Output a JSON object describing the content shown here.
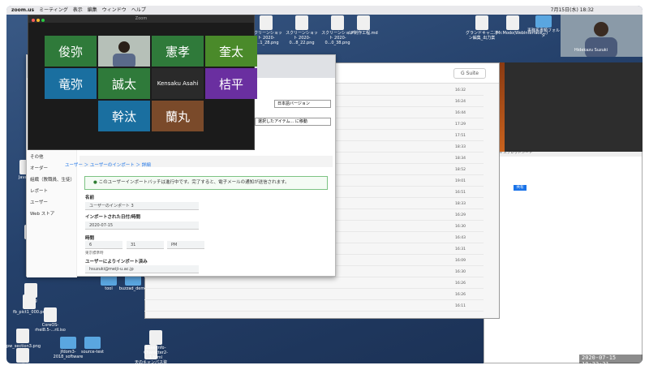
{
  "menubar": {
    "items": [
      "zoom.us",
      "ミーティング",
      "表示",
      "編集",
      "ウィンドウ",
      "ヘルプ"
    ],
    "clock": "7月15日(水) 18:32"
  },
  "desktop_icons": [
    {
      "label": "config"
    },
    {
      "label": "fb_pict1_000.png"
    },
    {
      "label": "CoreOS-rhel8.5-...ril.iso"
    },
    {
      "label": "pw_section3.png"
    },
    {
      "label": "Pepper資料.jpg"
    },
    {
      "label": "tool"
    },
    {
      "label": "buzzad_demo"
    },
    {
      "label": "jfdom3-2018_software"
    },
    {
      "label": "source-test"
    },
    {
      "label": "天のキャンパス資料 2020.pdf"
    },
    {
      "label": "base-info-Character2-1.html"
    },
    {
      "label": "Java-ka"
    },
    {
      "label": "Crea"
    }
  ],
  "top_icons": [
    {
      "label": "スクリーンショット 2020-0...1_28.png"
    },
    {
      "label": "スクリーンショット 2020-0...8_22.png"
    },
    {
      "label": "スクリーンショット 2020-0...0_38.png"
    },
    {
      "label": "LP制作工程.md"
    },
    {
      "label": "グランドキャニオン編集_出力案"
    },
    {
      "label": "Mr.Modo(WebInterface...)"
    },
    {
      "label": "事務系書類フォルダ"
    }
  ],
  "zoom": {
    "title": "Zoom",
    "participants": [
      {
        "name": "俊弥",
        "color": "#2f7a3a"
      },
      {
        "name": "",
        "color": "#6b6b6b",
        "video": true
      },
      {
        "name": "憲孝",
        "color": "#2f7a3a"
      },
      {
        "name": "奎太",
        "color": "#4a8a2a"
      },
      {
        "name": "竜弥",
        "color": "#1a6fa0"
      },
      {
        "name": "誠太",
        "color": "#2f7a3a"
      },
      {
        "name": "Kensaku Asahi",
        "color": "#2a2a2a",
        "small": true
      },
      {
        "name": "桔平",
        "color": "#6a2fa0"
      },
      {
        "name": "幹汰",
        "color": "#1a6fa0"
      },
      {
        "name": "蘭丸",
        "color": "#7a4a2a"
      }
    ]
  },
  "admin": {
    "sidebar": [
      "その他",
      "オーダー",
      "組織（教職員、生徒）",
      "レポート",
      "ユーザー",
      "Web ストア"
    ],
    "breadcrumb": "ユーザー ＞ ユーザーのインポート ＞ 詳細",
    "notice": "このユーザーインポートバッチは進行中です。完了すると、電子メールの通知が送信されます。",
    "name_label": "名前",
    "name_value": "ユーザーのインポート 3",
    "date_label": "インポートされた日付/時間",
    "date_value": "2020-07-15",
    "time_label": "時間",
    "hour": "6",
    "minute": "31",
    "ampm": "PM",
    "timezone": "東京標準時",
    "importer_label": "ユーザーによりインポート済み",
    "importer_value": "hsuzuki@meiji-u.ac.jp",
    "lang_select": "日本語バージョン",
    "move_select": "選択したアイテム... に移動"
  },
  "gmail": {
    "gsuite": "G Suite",
    "times": [
      "16:32",
      "16:24",
      "16:44",
      "17:29",
      "17:51",
      "18:33",
      "18:34",
      "18:52",
      "19:01",
      "16:51",
      "18:33",
      "16:29",
      "16:30",
      "16:43",
      "16:31",
      "16:09",
      "16:30",
      "16:26",
      "16:26",
      "16:11"
    ]
  },
  "sheet": {
    "header": "Google スプレッドシート",
    "btn": "共有"
  },
  "video_label": "Hidekazu Suzuki",
  "timestamp": "2020-07-15  18:32:31"
}
